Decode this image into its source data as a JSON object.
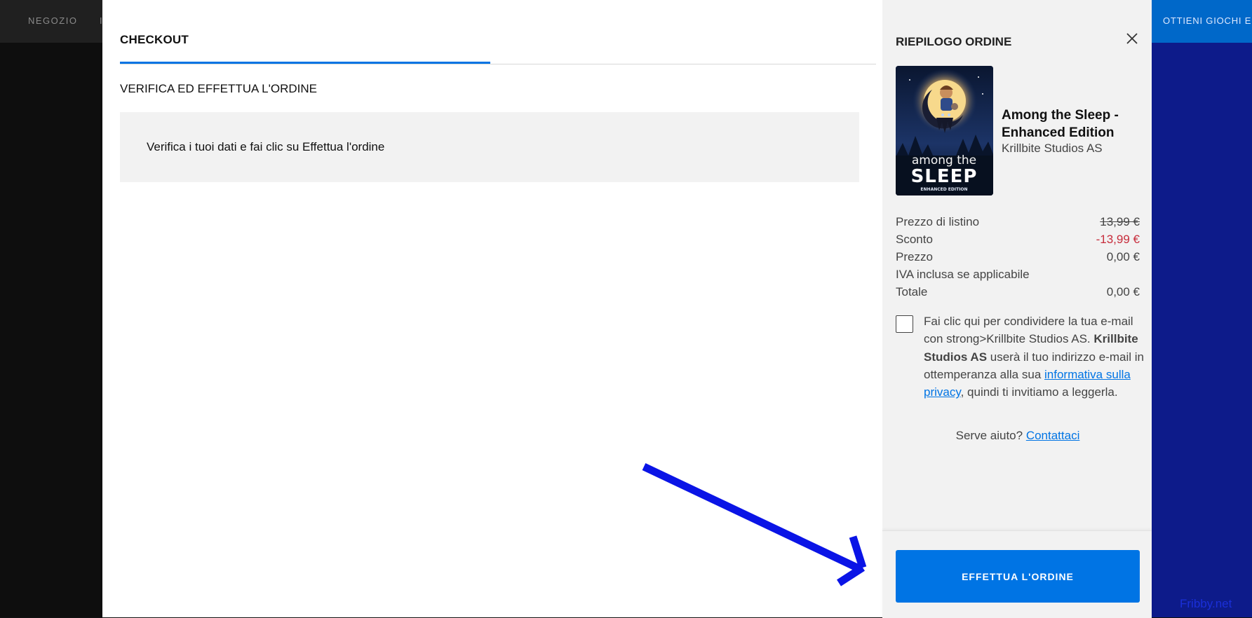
{
  "background_nav": {
    "store_label": "NEGOZIO",
    "partial_label": "I",
    "promo_label": "OTTIENI GIOCHI EPIC"
  },
  "checkout": {
    "title": "CHECKOUT",
    "step_title": "VERIFICA ED EFFETTUA L'ORDINE",
    "instruction": "Verifica i tuoi dati e fai clic su Effettua l'ordine"
  },
  "summary": {
    "title": "RIEPILOGO ORDINE",
    "product": {
      "title": "Among the Sleep - Enhanced Edition",
      "publisher": "Krillbite Studios AS",
      "cover_text": "among the",
      "cover_text_big": "SLEEP",
      "cover_text_small": "ENHANCED EDITION"
    },
    "prices": [
      {
        "label": "Prezzo di listino",
        "value": "13,99 €"
      },
      {
        "label": "Sconto",
        "value": "-13,99 €"
      },
      {
        "label": "Prezzo",
        "value": "0,00 €"
      },
      {
        "label": "IVA inclusa se applicabile",
        "value": ""
      },
      {
        "label": "Totale",
        "value": "0,00 €"
      }
    ],
    "consent": {
      "part1": "Fai clic qui per condividere la tua e-mail con strong>Krillbite Studios AS. ",
      "bold": "Krillbite Studios AS",
      "part2": " userà il tuo indirizzo e-mail in ottemperanza alla sua ",
      "link": "informativa sulla privacy",
      "part3": ", quindi ti invitiamo a leggerla."
    },
    "help": {
      "text": "Serve aiuto? ",
      "link": "Contattaci"
    },
    "place_order_label": "EFFETTUA L'ORDINE"
  },
  "watermark": "Fribby.net",
  "colors": {
    "accent": "#0074e4",
    "discount": "#c72c3b",
    "annotation_arrow": "#0a14e6"
  }
}
